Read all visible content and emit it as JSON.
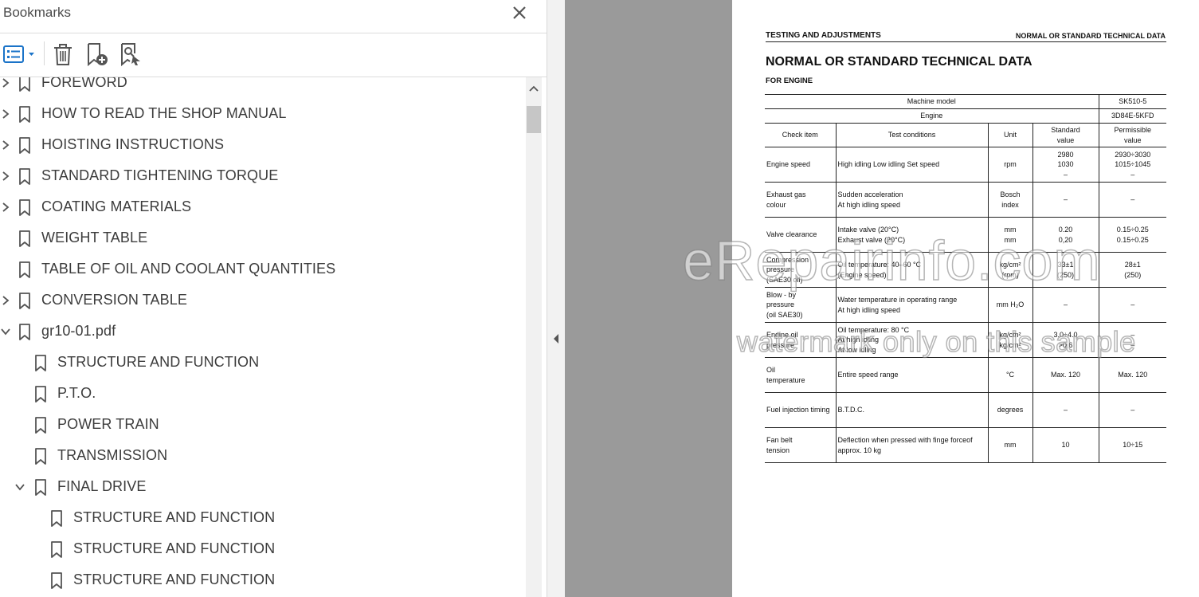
{
  "panel": {
    "title": "Bookmarks",
    "toolbar": {
      "options_icon": "list-options-icon",
      "delete_icon": "trash-icon",
      "new_bookmark_icon": "new-bookmark-icon",
      "find_bookmark_icon": "find-current-bookmark-icon"
    }
  },
  "bookmarks": [
    {
      "label": "FOREWORD",
      "level": 0,
      "expander": "collapsed"
    },
    {
      "label": "HOW TO READ THE SHOP MANUAL",
      "level": 0,
      "expander": "collapsed"
    },
    {
      "label": "HOISTING INSTRUCTIONS",
      "level": 0,
      "expander": "collapsed"
    },
    {
      "label": "STANDARD TIGHTENING TORQUE",
      "level": 0,
      "expander": "collapsed"
    },
    {
      "label": "COATING MATERIALS",
      "level": 0,
      "expander": "collapsed"
    },
    {
      "label": "WEIGHT TABLE",
      "level": 0,
      "expander": "none"
    },
    {
      "label": "TABLE OF OIL AND COOLANT QUANTITIES",
      "level": 0,
      "expander": "none"
    },
    {
      "label": "CONVERSION TABLE",
      "level": 0,
      "expander": "collapsed"
    },
    {
      "label": "gr10-01.pdf",
      "level": 0,
      "expander": "expanded"
    },
    {
      "label": "STRUCTURE AND FUNCTION",
      "level": 1,
      "expander": "none"
    },
    {
      "label": "P.T.O.",
      "level": 1,
      "expander": "none"
    },
    {
      "label": "POWER TRAIN",
      "level": 1,
      "expander": "none"
    },
    {
      "label": "TRANSMISSION",
      "level": 1,
      "expander": "none"
    },
    {
      "label": "FINAL DRIVE",
      "level": 1,
      "expander": "expanded"
    },
    {
      "label": "STRUCTURE AND FUNCTION",
      "level": 2,
      "expander": "none"
    },
    {
      "label": "STRUCTURE AND FUNCTION",
      "level": 2,
      "expander": "none"
    },
    {
      "label": "STRUCTURE AND FUNCTION",
      "level": 2,
      "expander": "none"
    }
  ],
  "document": {
    "header_left": "TESTING AND ADJUSTMENTS",
    "header_right": "NORMAL OR STANDARD TECHNICAL DATA",
    "title": "NORMAL OR STANDARD TECHNICAL DATA",
    "subtitle": "FOR ENGINE",
    "table": {
      "machine_model_label": "Machine model",
      "machine_model_value": "SK510-5",
      "engine_label": "Engine",
      "engine_value": "3D84E-5KFD",
      "headers": [
        "Check item",
        "Test conditions",
        "Unit",
        "Standard\nvalue",
        "Permissible\nvalue"
      ],
      "rows": [
        [
          "Engine speed",
          "High idling Low idling Set speed",
          "rpm",
          "2980\n1030\n–",
          "2930÷3030\n1015÷1045\n–"
        ],
        [
          "Exhaust gas\ncolour",
          "Sudden acceleration\nAt high idling speed",
          "Bosch\nindex",
          "–",
          "–"
        ],
        [
          "Valve clearance",
          "Intake valve (20°C)\nExhaust valve (20°C)",
          "mm\nmm",
          "0.20\n0,20",
          "0.15÷0.25\n0.15÷0.25"
        ],
        [
          "Compression\npressure\n(SAE30 oil)",
          "Oil temperature: 40–60 °C\n(Engine speed)",
          "kg/cm²\n(rpm)",
          "33±1\n(250)",
          "28±1\n(250)"
        ],
        [
          "Blow - by\npressure\n(oil SAE30)",
          "Water temperature in operating range\nAt high idling speed",
          "mm H₂O",
          "–",
          "–"
        ],
        [
          "Engine oil\npressure",
          "Oil temperature: 80 °C\nAt high idling\nAt low idling",
          "kg/cm²\nkg/cm²",
          "3.0÷4.0\n>0.6",
          "–\n–"
        ],
        [
          "Oil\ntemperature",
          "Entire speed range",
          "°C",
          "Max. 120",
          "Max. 120"
        ],
        [
          "Fuel injection timing",
          "B.T.D.C.",
          "degrees",
          "–",
          "–"
        ],
        [
          "Fan belt\ntension",
          "Deflection when pressed with finge forceof\napprox. 10 kg",
          "mm",
          "10",
          "10÷15"
        ]
      ]
    },
    "watermark_main": "eRepairinfo.com",
    "watermark_sub": "watermark only on this sample"
  }
}
